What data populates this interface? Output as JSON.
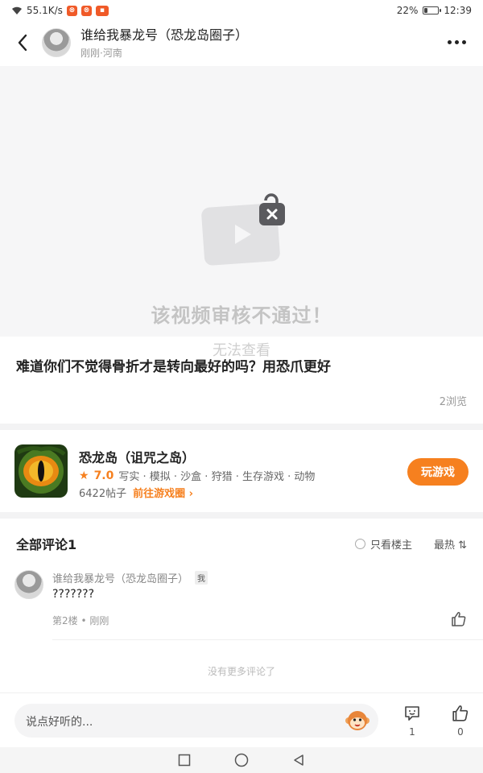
{
  "status_bar": {
    "speed": "55.1K/s",
    "battery": "22%",
    "battery_level": 0.22,
    "time": "12:39"
  },
  "header": {
    "title": "谁给我暴龙号（恐龙岛圈子）",
    "subtitle": "刚刚·河南",
    "back_icon": "chevron-left-icon",
    "more_icon": "more-dots-icon"
  },
  "video": {
    "status_title": "该视频审核不通过！",
    "status_sub": "无法查看"
  },
  "post": {
    "title": "难道你们不觉得骨折才是转向最好的吗？用恐爪更好",
    "views": "2浏览"
  },
  "game": {
    "name": "恐龙岛（诅咒之岛）",
    "rating": "7.0",
    "tags": "写实 · 模拟 · 沙盒 · 狩猎 · 生存游戏 · 动物",
    "posts": "6422帖子",
    "goto": "前往游戏圈 ›",
    "play_button": "玩游戏",
    "accent": "#f6801f"
  },
  "comments": {
    "title": "全部评论1",
    "only_host": "只看楼主",
    "sort": "最热 ⇅",
    "items": [
      {
        "author": "谁给我暴龙号（恐龙岛圈子）",
        "badge": "我",
        "text": "???????",
        "meta": "第2楼 • 刚刚"
      }
    ],
    "no_more": "没有更多评论了"
  },
  "bottom_bar": {
    "placeholder": "说点好听的...",
    "comment_count": "1",
    "like_count": "0"
  }
}
